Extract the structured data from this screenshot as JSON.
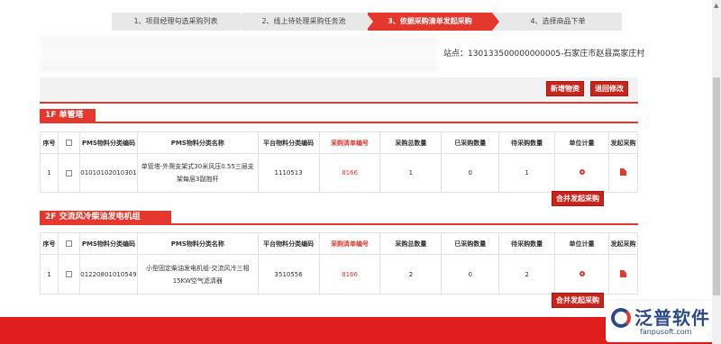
{
  "steps": [
    {
      "label": "1、项目经理勾选采购列表"
    },
    {
      "label": "2、线上待处理采购任务池"
    },
    {
      "label": "3、依据采购清单发起采购"
    },
    {
      "label": "4、选择商品下单"
    }
  ],
  "site_info": "站点：130133500000000005-石家庄市赵县高家庄村",
  "toolbar": {
    "new_label": "新增物资",
    "back_label": "退回修改"
  },
  "columns": [
    "序号",
    "",
    "PMS物料分类编码",
    "PMS物料分类名称",
    "平台物料分类编码",
    "采购清单编号",
    "采购总数量",
    "已采购数量",
    "待采购数量",
    "单位计量",
    "发起采购"
  ],
  "sections": [
    {
      "title": "1F 单管塔",
      "rows": [
        {
          "seq": "1",
          "pms_code": "01010102010301",
          "pms_name": "单管塔-外爬支架式30米风压0.55三层支架每层3副抱杆",
          "platform_code": "1110513",
          "list_no": "8166",
          "total": "1",
          "done": "0",
          "pending": "1"
        }
      ],
      "merge_label": "合并发起采购"
    },
    {
      "title": "2F 交流风冷柴油发电机组",
      "rows": [
        {
          "seq": "1",
          "pms_code": "01220801010549",
          "pms_name": "小型固定柴油发电机组-交流风冷三相15KW空气滤清器",
          "platform_code": "3510556",
          "list_no": "8166",
          "total": "2",
          "done": "0",
          "pending": "2"
        }
      ],
      "merge_label": "合并发起采购"
    }
  ],
  "logo": {
    "text": "泛普软件",
    "url": "fanpusoft.com"
  },
  "colors": {
    "accent": "#e4372d",
    "button": "#c8241b",
    "logo": "#2c4a8a"
  }
}
